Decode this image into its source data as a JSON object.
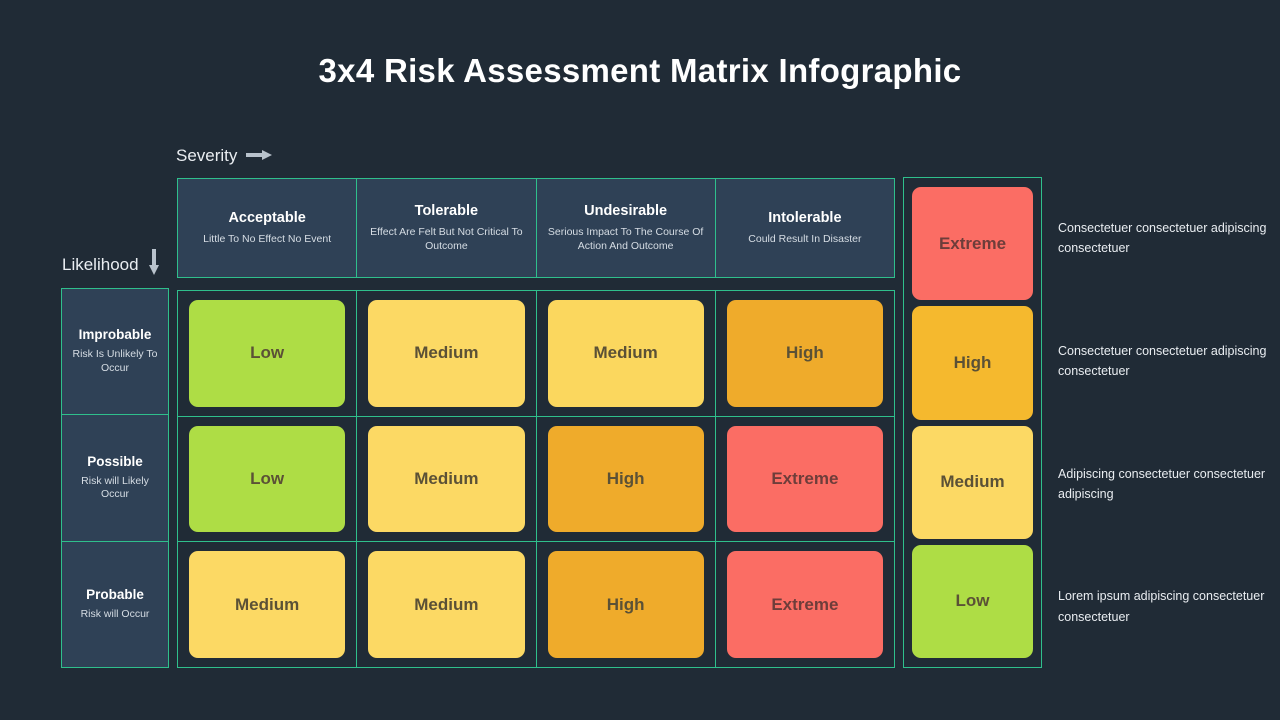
{
  "page": {
    "title": "3x4 Risk Assessment Matrix Infographic",
    "background_color": "#202b36",
    "border_color": "#2fbf8c",
    "header_cell_color": "#2f4156"
  },
  "axes": {
    "severity_label": "Severity",
    "severity_arrow_icon": "arrow-right-icon",
    "likelihood_label": "Likelihood",
    "likelihood_arrow_icon": "arrow-down-icon"
  },
  "chart_data": {
    "type": "heatmap",
    "title": "3x4 Risk Assessment Matrix Infographic",
    "xlabel": "Severity",
    "ylabel": "Likelihood",
    "categories": [
      "Acceptable",
      "Tolerable",
      "Undesirable",
      "Intolerable"
    ],
    "rows": [
      "Improbable",
      "Possible",
      "Probable"
    ],
    "values": [
      [
        "Low",
        "Medium",
        "Medium",
        "High"
      ],
      [
        "Low",
        "Medium",
        "High",
        "Extreme"
      ],
      [
        "Medium",
        "Medium",
        "High",
        "Extreme"
      ]
    ],
    "legend_position": "right"
  },
  "severity_columns": [
    {
      "title": "Acceptable",
      "desc": "Little To No Effect No Event"
    },
    {
      "title": "Tolerable",
      "desc": "Effect Are Felt But Not Critical To Outcome"
    },
    {
      "title": "Undesirable",
      "desc": "Serious Impact To The Course Of Action And Outcome"
    },
    {
      "title": "Intolerable",
      "desc": "Could Result In Disaster"
    }
  ],
  "likelihood_rows": [
    {
      "title": "Improbable",
      "desc": "Risk Is Unlikely To Occur"
    },
    {
      "title": "Possible",
      "desc": "Risk will Likely Occur"
    },
    {
      "title": "Probable",
      "desc": "Risk will Occur"
    }
  ],
  "matrix_cells": [
    [
      {
        "label": "Low",
        "color": "#aedd45"
      },
      {
        "label": "Medium",
        "color": "#fcd964"
      },
      {
        "label": "Medium",
        "color": "#fbd75e"
      },
      {
        "label": "High",
        "color": "#efab2b"
      }
    ],
    [
      {
        "label": "Low",
        "color": "#aedd45"
      },
      {
        "label": "Medium",
        "color": "#fcd964"
      },
      {
        "label": "High",
        "color": "#efab2b"
      },
      {
        "label": "Extreme",
        "color": "#fb6d64"
      }
    ],
    [
      {
        "label": "Medium",
        "color": "#fcd964"
      },
      {
        "label": "Medium",
        "color": "#fcd964"
      },
      {
        "label": "High",
        "color": "#efab2b"
      },
      {
        "label": "Extreme",
        "color": "#fb6d64"
      }
    ]
  ],
  "legend": [
    {
      "label": "Extreme",
      "color": "#fb6d64",
      "desc": "Consectetuer consectetuer adipiscing consectetuer"
    },
    {
      "label": "High",
      "color": "#f5b92e",
      "desc": "Consectetuer consectetuer adipiscing consectetuer"
    },
    {
      "label": "Medium",
      "color": "#fcd964",
      "desc": "Adipiscing consectetuer consectetuer adipiscing"
    },
    {
      "label": "Low",
      "color": "#aedd45",
      "desc": "Lorem ipsum adipiscing consectetuer consectetuer"
    }
  ]
}
